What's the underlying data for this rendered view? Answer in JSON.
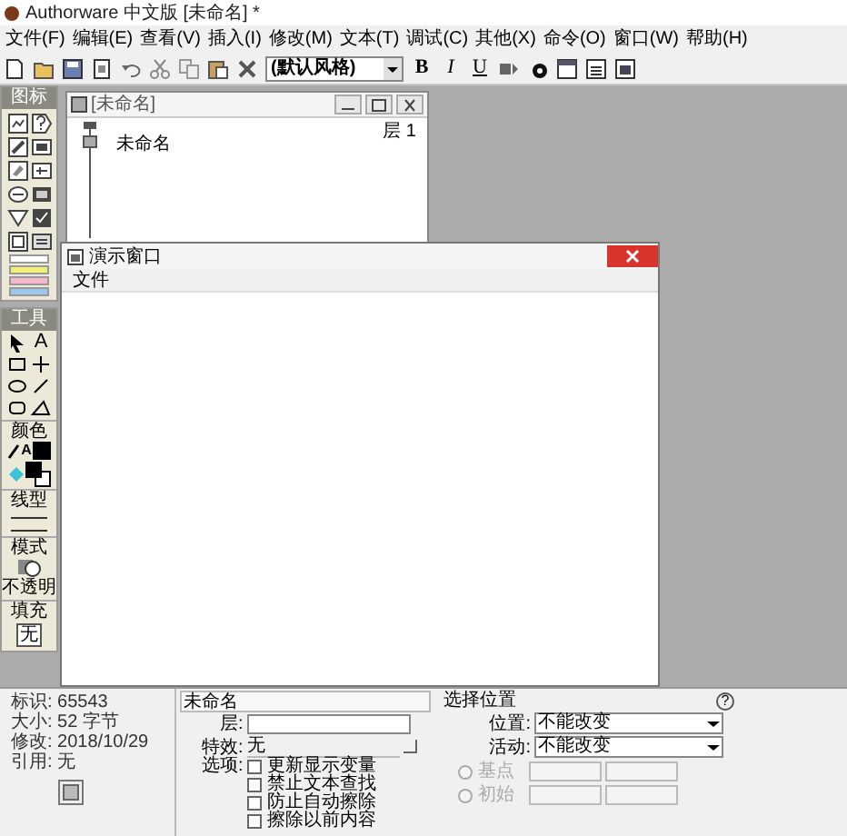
{
  "window": {
    "title": "Authorware 中文版 [未命名] *"
  },
  "menu": [
    "文件(F)",
    "编辑(E)",
    "查看(V)",
    "插入(I)",
    "修改(M)",
    "文本(T)",
    "调试(C)",
    "其他(X)",
    "命令(O)",
    "窗口(W)",
    "帮助(H)"
  ],
  "toolbar": {
    "style_dropdown": "(默认风格)",
    "format_buttons": [
      "B",
      "I",
      "U"
    ]
  },
  "icon_palette": {
    "title": "图标"
  },
  "flowline_window": {
    "title": "[未命名]",
    "file_name": "未命名",
    "layer": "层 1"
  },
  "presentation_window": {
    "title": "演示窗口",
    "menu": [
      "文件"
    ]
  },
  "tools_palette": {
    "title": "工具",
    "text_tool": "A",
    "color_label": "颜色",
    "text_color_mark": "A",
    "line_label": "线型",
    "mode_label": "模式",
    "mode_value": "不透明",
    "fill_label": "填充",
    "fill_value": "无"
  },
  "properties": {
    "info": [
      "标识: 65543",
      "大小: 52 字节",
      "修改: 2018/10/29",
      "引用: 无"
    ],
    "name": "未命名",
    "layer_label": "层:",
    "effect_label": "特效:",
    "effect": "无",
    "options_label": "选项:",
    "options": [
      {
        "label": "更新显示变量",
        "checked": false
      },
      {
        "label": "禁止文本查找",
        "checked": false
      },
      {
        "label": "防止自动擦除",
        "checked": false
      },
      {
        "label": "擦除以前内容",
        "checked": false
      }
    ],
    "position": {
      "title": "选择位置",
      "help": "?",
      "position_label": "位置:",
      "position_value": "不能改变",
      "movable_label": "活动:",
      "movable_value": "不能改变",
      "radios": [
        {
          "label": "基点",
          "selected": false,
          "disabled": true
        },
        {
          "label": "初始",
          "selected": false,
          "disabled": true
        }
      ]
    }
  }
}
